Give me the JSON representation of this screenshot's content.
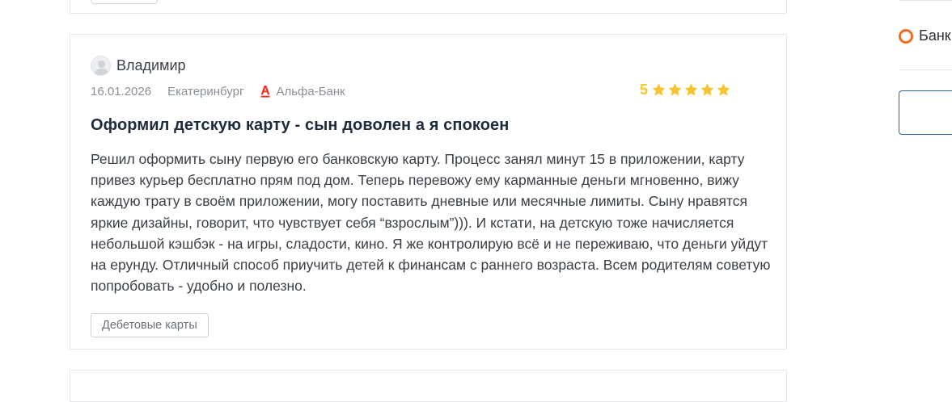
{
  "review": {
    "author": "Владимир",
    "date": "16.01.2026",
    "city": "Екатеринбург",
    "bank": "Альфа-Банк",
    "rating": "5",
    "stars": 5,
    "title": "Оформил детскую карту - сын доволен а я спокоен",
    "text": "Решил оформить сыну первую его банковскую карту. Процесс занял минут 15 в приложении, карту привез курьер бесплатно прям под дом. Теперь перевожу ему карманные деньги мгновенно, вижу каждую трату в своём приложении, могу поставить дневные или месячные лимиты. Сыну нравятся яркие дизайны, говорит, что чувствует себя “взрослым”))). И кстати, на детскую тоже начисляется небольшой кэшбэк - на игры, сладости, кино. Я же контролирую всё и не переживаю, что деньги уйдут на ерунду. Отличный способ приучить детей к финансам с раннего возраста. Всем родителям советую попробовать - удобно и полезно.",
    "tag": "Дебетовые карты"
  },
  "sidebar": {
    "radio_label": "Банк"
  },
  "colors": {
    "star": "#f5c430",
    "bank_logo": "#ef3124",
    "radio": "#f26a21",
    "input_border": "#2f5fa8",
    "title": "#1d2b3f"
  },
  "icons": {
    "avatar": "user-avatar-icon",
    "bank": "alfa-bank-logo-icon",
    "star": "star-icon"
  }
}
